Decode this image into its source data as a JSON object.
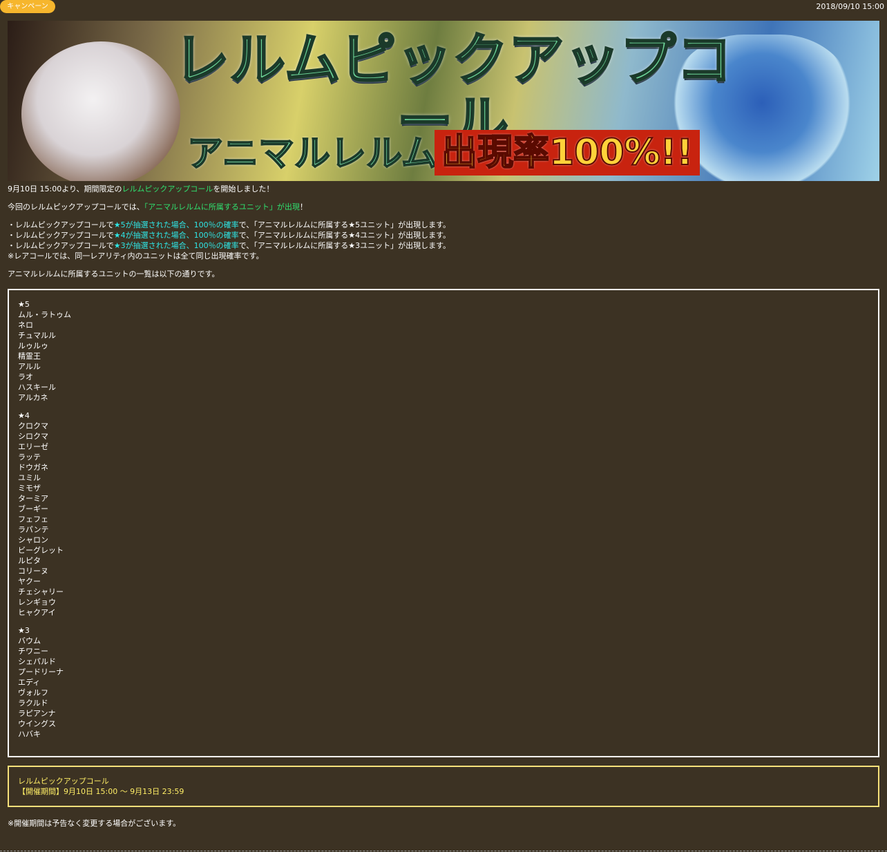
{
  "header": {
    "badge": "キャンペーン",
    "date": "2018/09/10 15:00"
  },
  "banner": {
    "title": "レルムピックアップコール",
    "subtitle_left": "アニマルレルム",
    "subtitle_right": "出現率100%!!"
  },
  "intro": {
    "line1_pre": "9月10日 15:00より、期間限定の",
    "line1_link": "レルムピックアップコール",
    "line1_post": "を開始しました！",
    "line2_pre": "今回のレルムピックアップコールでは、",
    "line2_highlight": "「アニマルレルムに所属するユニット」が出現",
    "line2_post": "！"
  },
  "rates": [
    {
      "pre": "・レルムピックアップコールで",
      "hl": "★5が抽選された場合、100％の確率",
      "post": "で、「アニマルレルムに所属する★5ユニット」が出現します。"
    },
    {
      "pre": "・レルムピックアップコールで",
      "hl": "★4が抽選された場合、100％の確率",
      "post": "で、「アニマルレルムに所属する★4ユニット」が出現します。"
    },
    {
      "pre": "・レルムピックアップコールで",
      "hl": "★3が抽選された場合、100％の確率",
      "post": "で、「アニマルレルムに所属する★3ユニット」が出現します。"
    }
  ],
  "rare_note": "※レアコールでは、同一レアリティ内のユニットは全て同じ出現確率です。",
  "list_intro": "アニマルレルムに所属するユニットの一覧は以下の通りです。",
  "units": {
    "star5": {
      "label": "★5",
      "names": [
        "ムル・ラトゥム",
        "ネロ",
        "チュマルル",
        "ルゥルゥ",
        "精霊王",
        "アルル",
        "ラオ",
        "ハスキール",
        "アルカネ"
      ]
    },
    "star4": {
      "label": "★4",
      "names": [
        "クロクマ",
        "シロクマ",
        "エリーゼ",
        "ラッテ",
        "ドウガネ",
        "ユミル",
        "ミモザ",
        "ターミア",
        "ブーギー",
        "フェフェ",
        "ラパンテ",
        "シャロン",
        "ビーグレット",
        "ルピタ",
        "コリーヌ",
        "ヤクー",
        "チェシャリー",
        "レンギョウ",
        "ヒャクアイ"
      ]
    },
    "star3": {
      "label": "★3",
      "names": [
        "バウム",
        "チワニー",
        "シェパルド",
        "プードリーナ",
        "エディ",
        "ヴォルフ",
        "ラクルド",
        "ラピアンナ",
        "ウイングス",
        "ハバキ"
      ]
    }
  },
  "event": {
    "name": "レルムピックアップコール",
    "period": "【開催期間】9月10日 15:00 ～ 9月13日 23:59"
  },
  "footer_note": "※開催期間は予告なく変更する場合がございます。",
  "colors": {
    "background": "#3c3223",
    "badge": "#f6b62d",
    "link_green": "#2fe06f",
    "highlight_cyan": "#2ee6e6",
    "event_yellow": "#ffee66"
  }
}
